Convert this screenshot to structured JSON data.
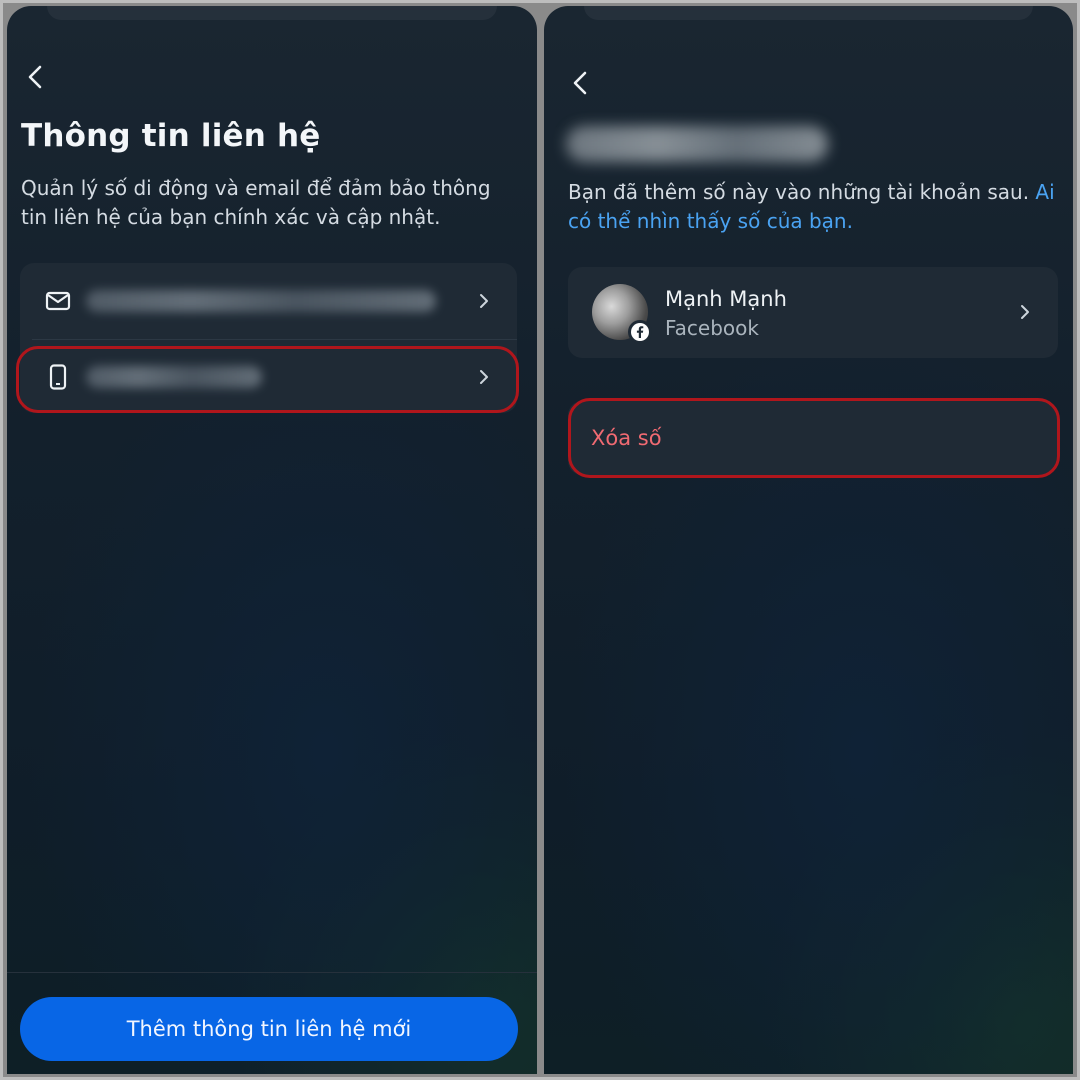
{
  "left": {
    "title": "Thông tin liên hệ",
    "description": "Quản lý số di động và email để đảm bảo thông tin liên hệ của bạn chính xác và cập nhật.",
    "contacts": [
      {
        "icon": "mail-icon",
        "value_blurred": true
      },
      {
        "icon": "phone-icon",
        "value_blurred": true
      }
    ],
    "add_button_label": "Thêm thông tin liên hệ mới"
  },
  "right": {
    "phone_blurred": true,
    "description_text": "Bạn đã thêm số này vào những tài khoản sau. ",
    "description_link": "Ai có thể nhìn thấy số của bạn.",
    "account": {
      "name": "Mạnh Mạnh",
      "platform": "Facebook"
    },
    "delete_label": "Xóa số"
  },
  "colors": {
    "primary": "#0866e6",
    "link": "#4aa3f2",
    "danger": "#f06a72",
    "highlight": "#b0161c"
  }
}
